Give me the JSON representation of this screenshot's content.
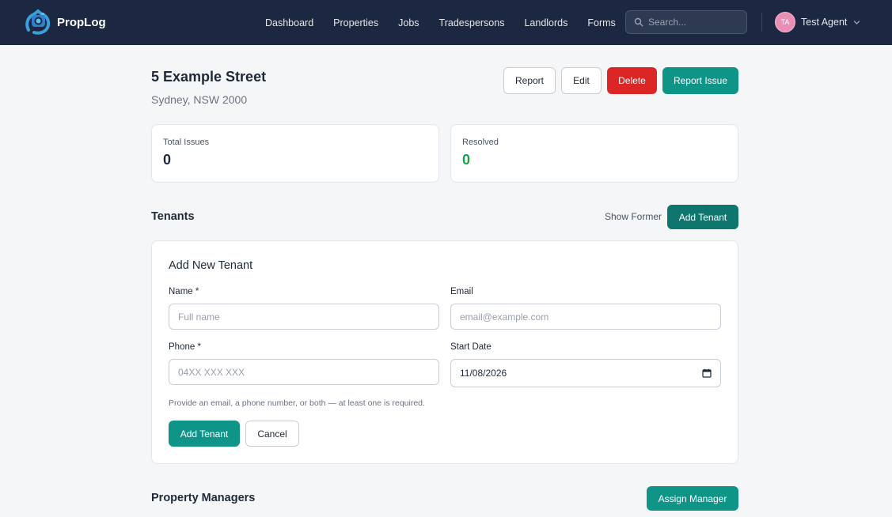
{
  "app": {
    "name": "PropLog"
  },
  "nav": {
    "links": [
      "Dashboard",
      "Properties",
      "Jobs",
      "Tradespersons",
      "Landlords",
      "Forms"
    ],
    "search_placeholder": "Search...",
    "user_initials": "TA",
    "user_name": "Test Agent"
  },
  "property": {
    "title": "5 Example Street",
    "subtitle": "Sydney, NSW 2000"
  },
  "actions": {
    "report": "Report",
    "edit": "Edit",
    "delete": "Delete",
    "report_issue": "Report Issue"
  },
  "stats": {
    "total_issues_label": "Total Issues",
    "total_issues_value": "0",
    "resolved_label": "Resolved",
    "resolved_value": "0"
  },
  "tenants": {
    "title": "Tenants",
    "show_former": "Show Former",
    "add_button": "Add Tenant"
  },
  "tenant_form": {
    "title": "Add New Tenant",
    "name_label": "Name *",
    "name_placeholder": "Full name",
    "email_label": "Email",
    "email_placeholder": "email@example.com",
    "phone_label": "Phone *",
    "phone_placeholder": "04XX XXX XXX",
    "start_date_label": "Start Date",
    "start_date_value": "11/08/2026",
    "help": "Provide an email, a phone number, or both — at least one is required.",
    "submit": "Add Tenant",
    "cancel": "Cancel"
  },
  "managers": {
    "title": "Property Managers",
    "assign_button": "Assign Manager"
  },
  "colors": {
    "nav_bg": "#1c2841",
    "teal": "#0f9488",
    "teal_dark": "#0f766e",
    "danger": "#dc2626",
    "resolved_green": "#16a34a"
  }
}
